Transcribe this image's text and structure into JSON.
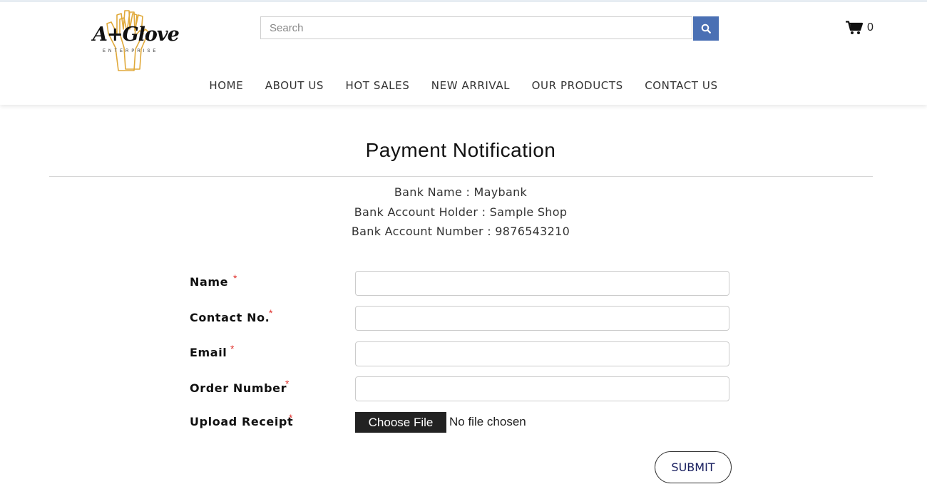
{
  "brand": {
    "logo_text": "A+Glove",
    "logo_sub": "ENTERPRISE"
  },
  "search": {
    "placeholder": "Search"
  },
  "cart": {
    "count": "0"
  },
  "nav": [
    "HOME",
    "ABOUT US",
    "HOT SALES",
    "NEW ARRIVAL",
    "OUR PRODUCTS",
    "CONTACT US"
  ],
  "page": {
    "title": "Payment Notification",
    "bank_name": "Bank Name : Maybank",
    "bank_holder": "Bank Account Holder : Sample Shop",
    "bank_number": "Bank Account Number : 9876543210"
  },
  "form": {
    "name_label": "Name",
    "contact_label": "Contact No.",
    "email_label": "Email",
    "order_label": "Order Number",
    "receipt_label": "Upload Receipt",
    "required_mark": "*",
    "choose_file": "Choose File",
    "file_status": "No file chosen",
    "submit": "SUBMIT"
  },
  "colors": {
    "accent": "#4a70b4",
    "required": "#e0332e",
    "submit_text": "#1a2060"
  }
}
